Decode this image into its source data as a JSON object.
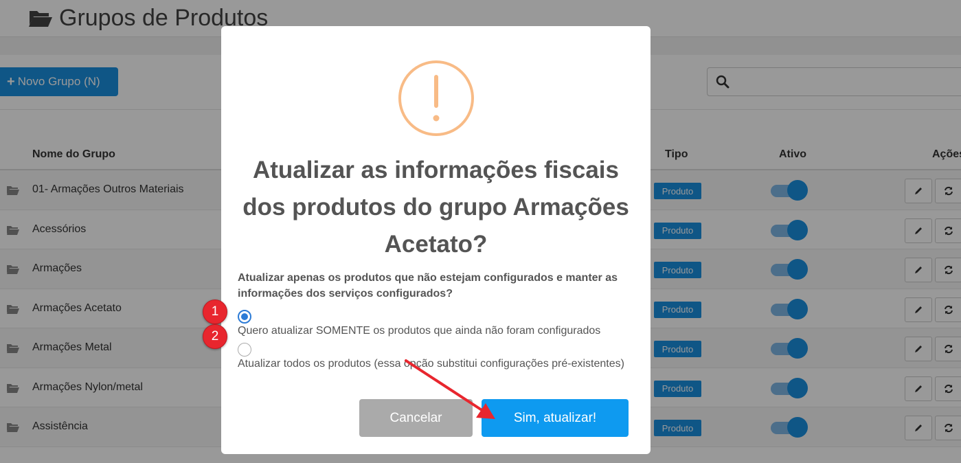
{
  "page": {
    "title": "Grupos de Produtos",
    "new_button_label": "Novo Grupo (N)",
    "search_placeholder": ""
  },
  "table": {
    "headers": {
      "name": "Nome do Grupo",
      "type": "Tipo",
      "active": "Ativo",
      "actions": "Ações"
    },
    "rows": [
      {
        "name": "01- Armações Outros Materiais",
        "type": "Produto",
        "active": true
      },
      {
        "name": "Acessórios",
        "type": "Produto",
        "active": true
      },
      {
        "name": "Armações",
        "type": "Produto",
        "active": true
      },
      {
        "name": "Armações Acetato",
        "type": "Produto",
        "active": true
      },
      {
        "name": "Armações Metal",
        "type": "Produto",
        "active": true
      },
      {
        "name": "Armações Nylon/metal",
        "type": "Produto",
        "active": true
      },
      {
        "name": "Assistência",
        "type": "Produto",
        "active": true
      }
    ]
  },
  "modal": {
    "icon": "warning-icon",
    "title": "Atualizar as informações fiscais dos produtos do grupo Armações Acetato?",
    "question": "Atualizar apenas os produtos que não estejam configurados e manter as informações dos serviços configurados?",
    "options": [
      {
        "label": "Quero atualizar SOMENTE os produtos que ainda não foram configurados",
        "checked": true
      },
      {
        "label": "Atualizar todos os produtos (essa opção substitui configurações pré-existentes)",
        "checked": false
      }
    ],
    "cancel_label": "Cancelar",
    "confirm_label": "Sim, atualizar!"
  },
  "annotations": {
    "marker_1": "1",
    "marker_2": "2"
  },
  "colors": {
    "primary": "#1a8fe0",
    "confirm": "#0e9af0",
    "cancel": "#aaaaaa",
    "warning": "#f8bb86",
    "marker": "#e8262e"
  }
}
